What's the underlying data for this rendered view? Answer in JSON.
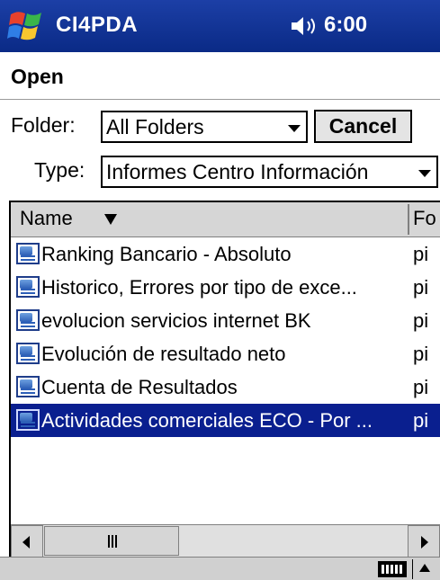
{
  "titlebar": {
    "app_title": "CI4PDA",
    "time": "6:00",
    "start_icon": "windows-flag-icon",
    "volume_icon": "speaker-icon"
  },
  "dialog": {
    "title": "Open",
    "folder_label": "Folder:",
    "folder_value": "All Folders",
    "cancel_label": "Cancel",
    "type_label": "Type:",
    "type_value": "Informes Centro Información"
  },
  "list": {
    "columns": [
      "Name",
      "Fo"
    ],
    "rows": [
      {
        "name": "Ranking Bancario - Absoluto",
        "folder": "pi"
      },
      {
        "name": "Historico, Errores por tipo de exce...",
        "folder": "pi"
      },
      {
        "name": "evolucion servicios internet BK",
        "folder": "pi"
      },
      {
        "name": "Evolución de resultado neto",
        "folder": "pi"
      },
      {
        "name": "Cuenta de Resultados",
        "folder": "pi"
      },
      {
        "name": "Actividades comerciales ECO - Por ...",
        "folder": "pi"
      }
    ],
    "selected_index": 5
  },
  "colors": {
    "titlebar": "#0a2a86",
    "selection": "#0a1f8f"
  }
}
